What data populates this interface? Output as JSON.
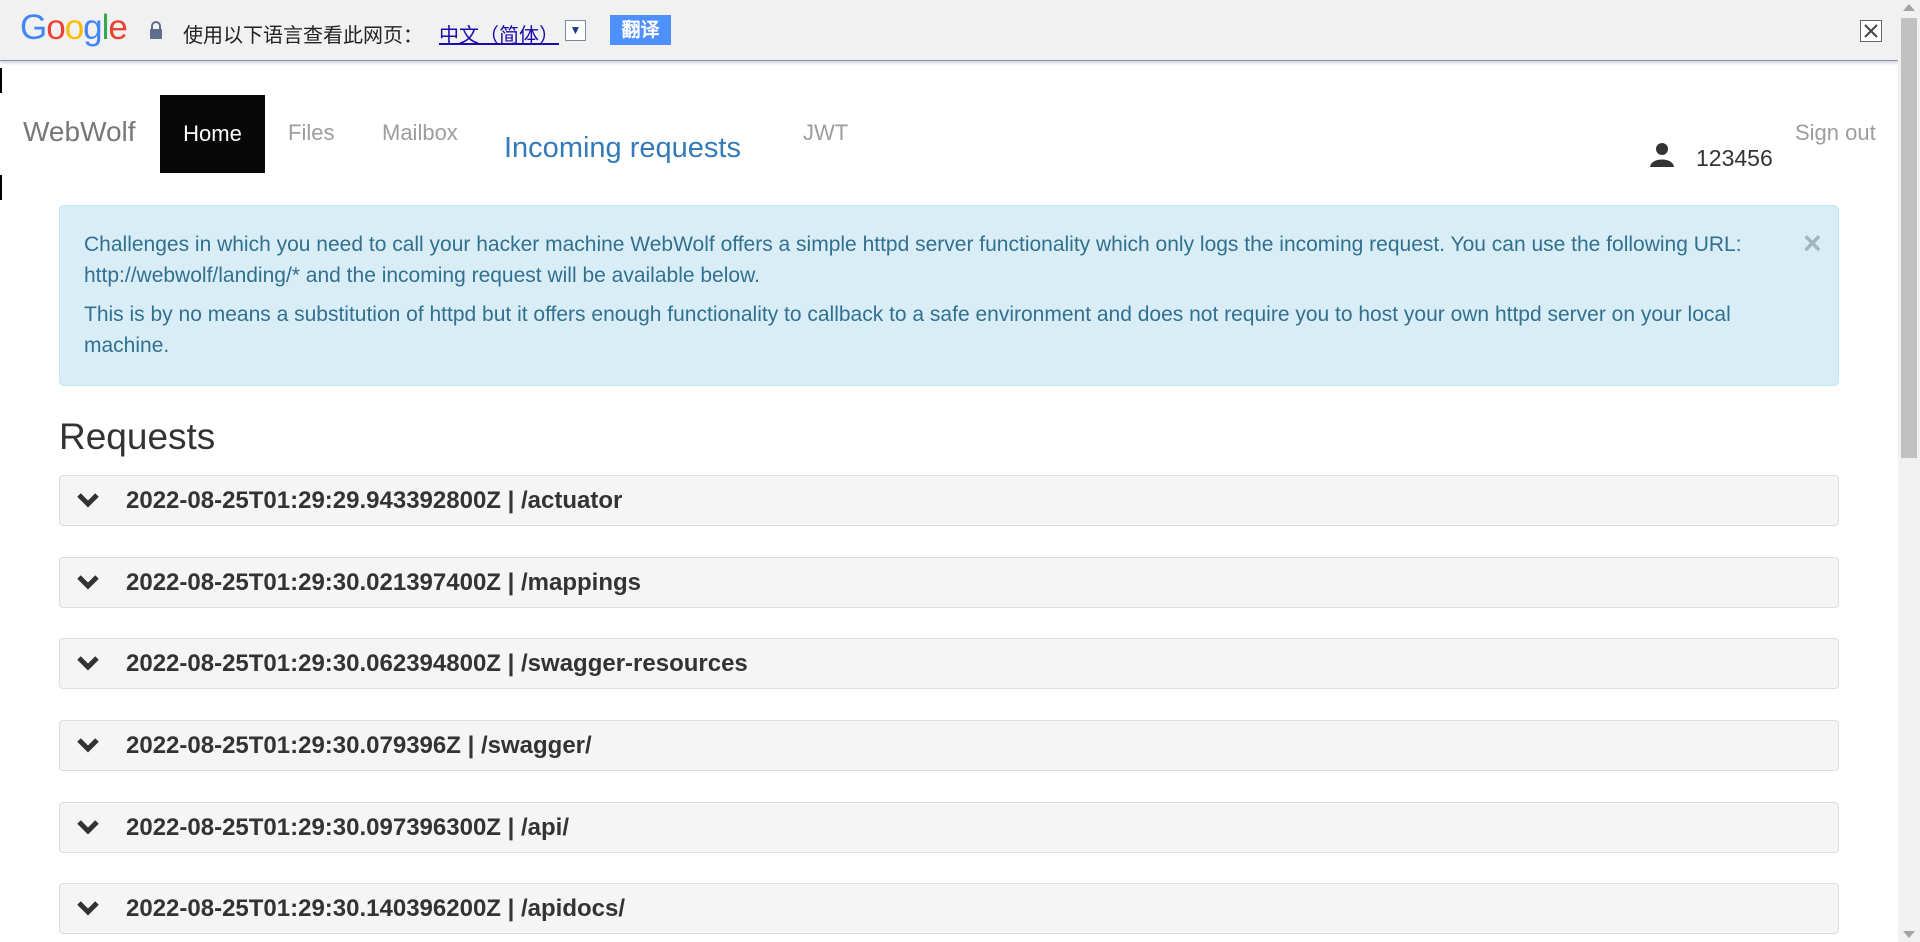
{
  "translate_bar": {
    "logo": [
      "G",
      "o",
      "o",
      "g",
      "l",
      "e"
    ],
    "logo_colors": [
      "#4285f4",
      "#ea4335",
      "#fbbc05",
      "#4285f4",
      "#34a853",
      "#ea4335"
    ],
    "prompt": "使用以下语言查看此网页：",
    "language": "中文（简体）",
    "dropdown_glyph": "▼",
    "translate_button": "翻译",
    "close_glyph": "close-icon"
  },
  "navbar": {
    "brand": "WebWolf",
    "items": [
      {
        "label": "Home",
        "active": true
      },
      {
        "label": "Files"
      },
      {
        "label": "Mailbox"
      },
      {
        "label": "Incoming requests",
        "highlighted": true
      },
      {
        "label": "JWT"
      }
    ],
    "user": "123456",
    "signout": "Sign out"
  },
  "alert": {
    "paragraph1": "Challenges in which you need to call your hacker machine WebWolf offers a simple httpd server functionality which only logs the incoming request. You can use the following URL: http://webwolf/landing/* and the incoming request will be available below.",
    "paragraph2": "This is by no means a substitution of httpd but it offers enough functionality to callback to a safe environment and does not require you to host your own httpd server on your local machine.",
    "close": "×"
  },
  "requests": {
    "heading": "Requests",
    "items": [
      {
        "title": "2022-08-25T01:29:29.943392800Z | /actuator"
      },
      {
        "title": "2022-08-25T01:29:30.021397400Z | /mappings"
      },
      {
        "title": "2022-08-25T01:29:30.062394800Z | /swagger-resources"
      },
      {
        "title": "2022-08-25T01:29:30.079396Z | /swagger/"
      },
      {
        "title": "2022-08-25T01:29:30.097396300Z | /api/"
      },
      {
        "title": "2022-08-25T01:29:30.140396200Z | /apidocs/"
      }
    ]
  },
  "colors": {
    "accent_link": "#337ab7",
    "alert_bg": "#d9edf7",
    "alert_text": "#31708f",
    "nav_active_bg": "#080808",
    "translate_button_bg": "#4d90fe"
  }
}
